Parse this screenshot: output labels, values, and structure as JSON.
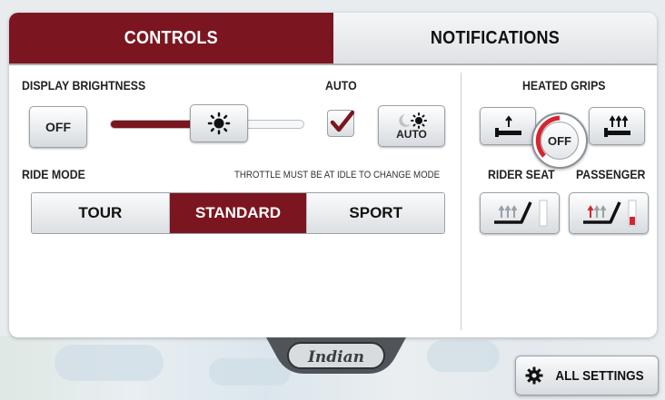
{
  "tabs": {
    "controls": "CONTROLS",
    "notifications": "NOTIFICATIONS"
  },
  "display": {
    "label": "DISPLAY BRIGHTNESS",
    "off_button": "OFF",
    "auto_label": "AUTO",
    "auto_button": "AUTO",
    "brightness_level": 0.5,
    "auto_checked": true
  },
  "ride_mode": {
    "label": "RIDE MODE",
    "note": "THROTTLE MUST BE AT IDLE TO CHANGE MODE",
    "options": [
      "TOUR",
      "STANDARD",
      "SPORT"
    ],
    "selected": "STANDARD"
  },
  "heated_grips": {
    "label": "HEATED GRIPS",
    "dial_value": "OFF"
  },
  "seats": {
    "rider_label": "RIDER SEAT",
    "passenger_label": "PASSENGER"
  },
  "footer": {
    "all_settings": "ALL SETTINGS",
    "logo_text": "Indian"
  },
  "colors": {
    "accent": "#7b1620",
    "heat_red": "#d3262e"
  }
}
